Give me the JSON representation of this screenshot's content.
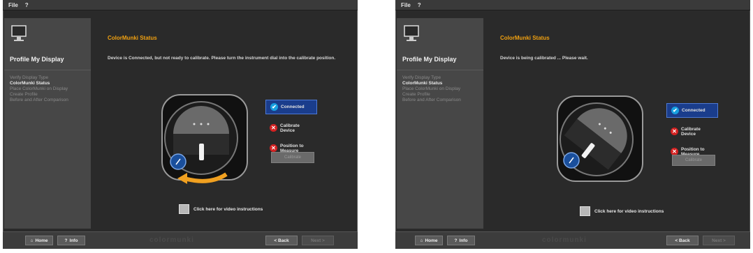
{
  "screens": [
    {
      "menu": {
        "file": "File",
        "help": "?"
      },
      "sidebar": {
        "title": "Profile My Display",
        "steps": [
          "Verify Display Type",
          "ColorMunki Status",
          "Place ColorMunki on Display",
          "Create Profile",
          "Before and After Comparison"
        ],
        "active_step": 1
      },
      "main": {
        "title": "ColorMunki Status",
        "message": "Device is Connected, but not ready to calibrate. Please turn the instrument dial into the calibrate position."
      },
      "status": [
        {
          "label": "Connected",
          "state": "ok"
        },
        {
          "label": "Calibrate Device",
          "state": "error"
        },
        {
          "label": "Position to Measure",
          "state": "error"
        }
      ],
      "calibrate_button": "Calibrate",
      "video_link": "Click here for video instructions",
      "footer": {
        "home": "Home",
        "help": "Info",
        "back": "< Back",
        "next": "Next >",
        "logo": "colormunki"
      }
    },
    {
      "menu": {
        "file": "File",
        "help": "?"
      },
      "sidebar": {
        "title": "Profile My Display",
        "steps": [
          "Verify Display Type",
          "ColorMunki Status",
          "Place ColorMunki on Display",
          "Create Profile",
          "Before and After Comparison"
        ],
        "active_step": 1
      },
      "main": {
        "title": "ColorMunki Status",
        "message": "Device is being calibrated ... Please wait."
      },
      "status": [
        {
          "label": "Connected",
          "state": "ok"
        },
        {
          "label": "Calibrate Device",
          "state": "error"
        },
        {
          "label": "Position to Measure",
          "state": "error"
        }
      ],
      "calibrate_button": "Calibrate",
      "video_link": "Click here for video instructions",
      "footer": {
        "home": "Home",
        "help": "Info",
        "back": "< Back",
        "next": "Next >",
        "logo": "colormunki"
      }
    }
  ],
  "colors": {
    "accent_title": "#f0a010",
    "selected_status": "#1a3d8c",
    "ok": "#18a0e0",
    "error": "#d32222"
  },
  "icons": {
    "monitor": "monitor-icon",
    "check": "check-icon",
    "error": "error-icon",
    "video": "video-icon",
    "home": "home-icon",
    "help": "help-icon"
  }
}
